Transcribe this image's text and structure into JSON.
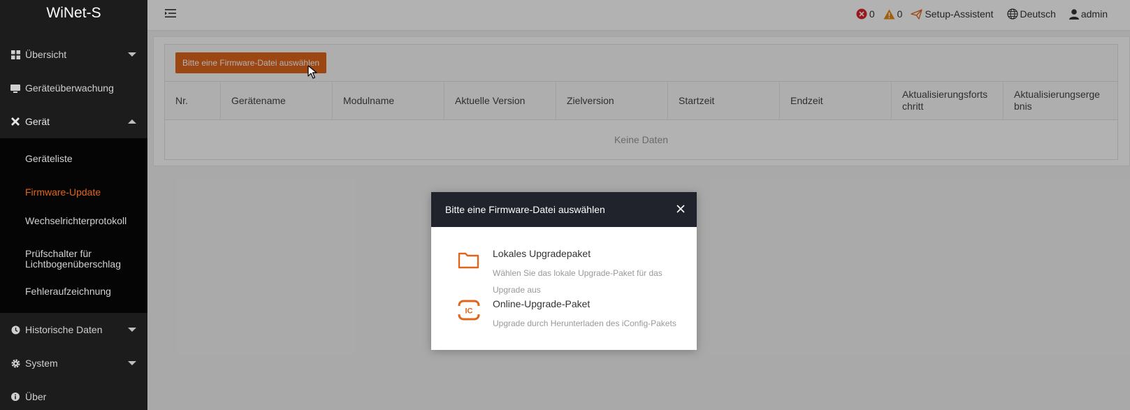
{
  "sidebar": {
    "brand": "WiNet-S",
    "items": [
      {
        "label": "Übersicht",
        "icon": "dashboard-icon"
      },
      {
        "label": "Geräteüberwachung",
        "icon": "monitor-icon"
      },
      {
        "label": "Gerät",
        "icon": "tools-icon"
      },
      {
        "label": "Historische Daten",
        "icon": "clock-icon"
      },
      {
        "label": "System",
        "icon": "gear-icon"
      },
      {
        "label": "Über",
        "icon": "info-icon"
      }
    ],
    "subitems": [
      {
        "label": "Geräteliste"
      },
      {
        "label": "Firmware-Update"
      },
      {
        "label": "Wechselrichterprotokoll"
      },
      {
        "label": "Prüfschalter für Lichtbogenüberschlag"
      },
      {
        "label": "Fehleraufzeichnung"
      }
    ]
  },
  "header": {
    "error_count": "0",
    "warning_count": "0",
    "setup_label": "Setup-Assistent",
    "language_label": "Deutsch",
    "user_label": "admin"
  },
  "main": {
    "select_button_label": "Bitte eine Firmware-Datei auswählen",
    "table": {
      "columns": [
        "Nr.",
        "Gerätename",
        "Modulname",
        "Aktuelle Version",
        "Zielversion",
        "Startzeit",
        "Endzeit",
        "Aktualisierungsfortschritt",
        "Aktualisierungsergebnis"
      ],
      "empty_text": "Keine Daten"
    }
  },
  "modal": {
    "title": "Bitte eine Firmware-Datei auswählen",
    "options": [
      {
        "title": "Lokales Upgradepaket",
        "description": "Wählen Sie das lokale Upgrade-Paket für das Upgrade aus",
        "icon": "folder-icon"
      },
      {
        "title": "Online-Upgrade-Paket",
        "description": "Upgrade durch Herunterladen des iConfig-Pakets",
        "icon": "iconfig-icon"
      }
    ]
  },
  "colors": {
    "accent": "#e0661c",
    "sidebar_bg": "#1c1c1c",
    "modal_header_bg": "#20222c",
    "error": "#d9252b",
    "warning": "#e58a10"
  }
}
